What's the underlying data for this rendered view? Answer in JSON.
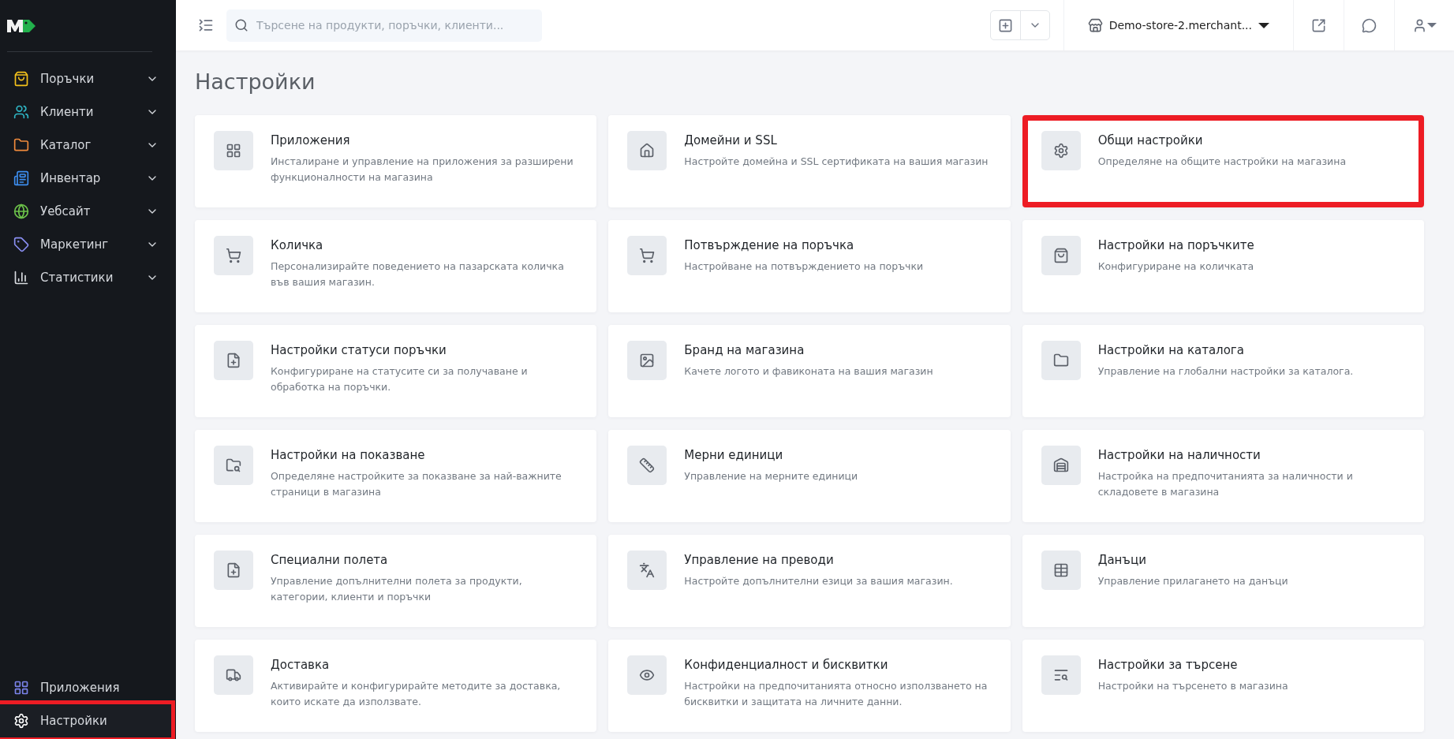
{
  "sidebar": {
    "items": [
      {
        "label": "Поръчки",
        "color": "#f5c21b",
        "expanded": false,
        "highlighted": false
      },
      {
        "label": "Клиенти",
        "color": "#2fb5c4",
        "expanded": false,
        "highlighted": false
      },
      {
        "label": "Каталог",
        "color": "#f08a3c",
        "expanded": false,
        "highlighted": false
      },
      {
        "label": "Инвентар",
        "color": "#3d8ef0",
        "expanded": false,
        "highlighted": false
      },
      {
        "label": "Уебсайт",
        "color": "#6cc24a",
        "expanded": false,
        "highlighted": false
      },
      {
        "label": "Маркетинг",
        "color": "#8a8ff2",
        "expanded": false,
        "highlighted": false
      },
      {
        "label": "Статистики",
        "color": "#d8dbe0",
        "expanded": false,
        "highlighted": false
      }
    ],
    "bottom_items": [
      {
        "label": "Приложения",
        "color": "#7b83eb",
        "highlighted": false
      },
      {
        "label": "Настройки",
        "color": "#ffffff",
        "highlighted": true
      }
    ]
  },
  "topbar": {
    "search": {
      "placeholder": "Търсене на продукти, поръчки, клиенти..."
    },
    "store": "Demo-store-2.merchant..."
  },
  "page": {
    "title": "Настройки"
  },
  "cards": [
    {
      "title": "Приложения",
      "description": "Инсталиране и управление на приложения за разширени функционалности на магазина",
      "highlighted": false
    },
    {
      "title": "Домейни и SSL",
      "description": "Настройте домейна и SSL сертификата на вашия магазин",
      "highlighted": false
    },
    {
      "title": "Общи настройки",
      "description": "Определяне на общите настройки на магазина",
      "highlighted": true
    },
    {
      "title": "Количка",
      "description": "Персонализирайте поведението на пазарската количка във вашия магазин.",
      "highlighted": false
    },
    {
      "title": "Потвърждение на поръчка",
      "description": "Настройване на потвърждението на поръчки",
      "highlighted": false
    },
    {
      "title": "Настройки на поръчките",
      "description": "Конфигуриране на количката",
      "highlighted": false
    },
    {
      "title": "Настройки статуси поръчки",
      "description": "Конфигуриране на статусите си за получаване и обработка на поръчки.",
      "highlighted": false
    },
    {
      "title": "Бранд на магазина",
      "description": "Качете логото и фавиконата на вашия магазин",
      "highlighted": false
    },
    {
      "title": "Настройки на каталога",
      "description": "Управление на глобални настройки за каталога.",
      "highlighted": false
    },
    {
      "title": "Настройки на показване",
      "description": "Определяне настройките за показване за най-важните страници в магазина",
      "highlighted": false
    },
    {
      "title": "Мерни единици",
      "description": "Управление на мерните единици",
      "highlighted": false
    },
    {
      "title": "Настройки на наличности",
      "description": "Настройка на предпочитанията за наличности и складовете в магазина",
      "highlighted": false
    },
    {
      "title": "Специални полета",
      "description": "Управление допълнителни полета за продукти, категории, клиенти и поръчки",
      "highlighted": false
    },
    {
      "title": "Управление на преводи",
      "description": "Настройте допълнителни езици за вашия магазин.",
      "highlighted": false
    },
    {
      "title": "Данъци",
      "description": "Управление прилагането на данъци",
      "highlighted": false
    },
    {
      "title": "Доставка",
      "description": "Активирайте и конфигурирайте методите за доставка, които искате да използвате.",
      "highlighted": false
    },
    {
      "title": "Конфиденциалност и бисквитки",
      "description": "Настройки на предпочитанията относно използването на бисквитки и защитата на личните данни.",
      "highlighted": false
    },
    {
      "title": "Настройки за търсене",
      "description": "Настройки на търсенето в магазина",
      "highlighted": false
    }
  ]
}
